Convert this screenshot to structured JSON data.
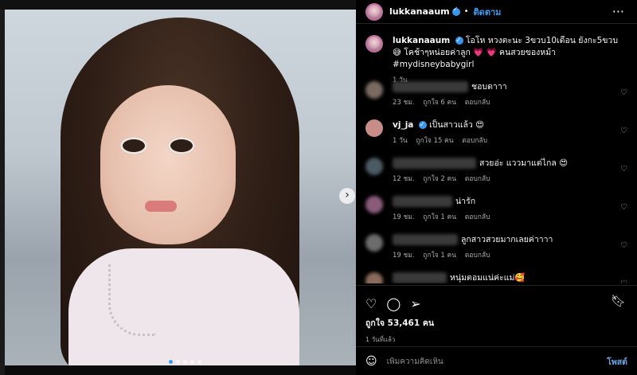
{
  "post": {
    "username": "lukkanaaum",
    "follow_label": "ติดตาม",
    "more_label": "···",
    "caption_text": "โอโห หวงตะนะ 3ขวบ10เดือน ยังกะ5ขวบ 😅 โคช้าๆหน่อยค่าลูก 💗 💗 คนสวยของหม้า #mydisneybabygirl",
    "caption_time": "1 วัน",
    "carousel_next": "›",
    "likes_text": "ถูกใจ 53,461 คน",
    "posted_time": "1 วันที่แล้ว",
    "add_comment_placeholder": "เพิ่มความคิดเห็น",
    "post_button": "โพสต์"
  },
  "comments": [
    {
      "name": "",
      "text": "ชอบดาาา",
      "time": "23 ชม.",
      "likes": "ถูกใจ 6 คน",
      "reply": "ตอบกลับ",
      "avatar_color": "#7a6a62"
    },
    {
      "name": "vj_ja",
      "verified": true,
      "text": "เป็นสาวแล้ว 😍",
      "time": "1 วัน",
      "likes": "ถูกใจ 15 คน",
      "reply": "ตอบกลับ",
      "avatar_color": "#c98d87"
    },
    {
      "name": "",
      "text": "สวยอ่ะ แววมาแต่ไกล 😍",
      "time": "12 ชม.",
      "likes": "ถูกใจ 2 คน",
      "reply": "ตอบกลับ",
      "avatar_color": "#4c5a63"
    },
    {
      "name": "",
      "text": "น่ารัก",
      "time": "19 ชม.",
      "likes": "ถูกใจ 1 คน",
      "reply": "ตอบกลับ",
      "avatar_color": "#8a5c7a"
    },
    {
      "name": "",
      "text": "ลูกสาวสวยมากเลยค่าาาา",
      "time": "19 ชม.",
      "likes": "ถูกใจ 1 คน",
      "reply": "ตอบกลับ",
      "avatar_color": "#6c6c6c"
    },
    {
      "name": "",
      "text": "หนุ่มตอมแน่ค่ะแม่🥰",
      "time": "",
      "likes": "",
      "reply": "",
      "avatar_color": "#8a6a5a"
    }
  ],
  "carousel": {
    "count": 5,
    "active_index": 0
  },
  "icons": [
    "heart-icon",
    "comment-icon",
    "share-icon",
    "bookmark-icon",
    "emoji-icon",
    "more-icon"
  ],
  "colors": {
    "accent": "#3d9bf0",
    "verified": "#3897f0",
    "background": "#000000"
  }
}
